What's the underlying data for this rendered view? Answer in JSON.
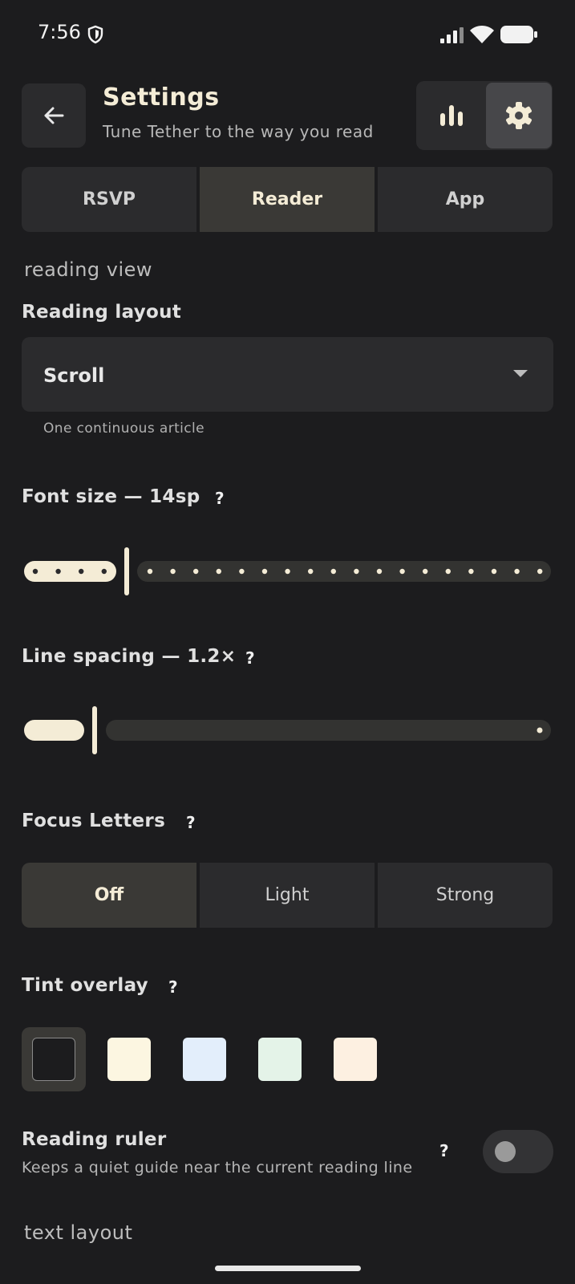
{
  "status_bar": {
    "time": "7:56"
  },
  "header": {
    "title": "Settings",
    "subtitle": "Tune Tether to the way you read"
  },
  "tabs": [
    {
      "label": "RSVP",
      "active": false
    },
    {
      "label": "Reader",
      "active": true
    },
    {
      "label": "App",
      "active": false
    }
  ],
  "sections": {
    "reading_view": "reading view",
    "text_layout": "text layout"
  },
  "reading_layout": {
    "label": "Reading layout",
    "value": "Scroll",
    "hint": "One continuous article"
  },
  "font_size": {
    "label": "Font size — 14sp",
    "help": "?",
    "value_sp": 14,
    "fraction": 0.19
  },
  "line_spacing": {
    "label": "Line spacing — 1.2×",
    "help": "?",
    "value": 1.2,
    "fraction": 0.13
  },
  "focus_letters": {
    "label": "Focus Letters",
    "help": "?",
    "options": [
      "Off",
      "Light",
      "Strong"
    ],
    "selected": "Off"
  },
  "tint_overlay": {
    "label": "Tint overlay",
    "help": "?",
    "swatches": [
      "none",
      "#fcf6e1",
      "#e3eefb",
      "#e4f3e8",
      "#fdf0e1"
    ],
    "selected": 0
  },
  "reading_ruler": {
    "label": "Reading ruler",
    "description": "Keeps a quiet guide near the current reading line",
    "help": "?",
    "enabled": false
  },
  "colors": {
    "background": "#1c1c1e",
    "surface": "#2b2b2d",
    "accent": "#f4ecd6"
  }
}
